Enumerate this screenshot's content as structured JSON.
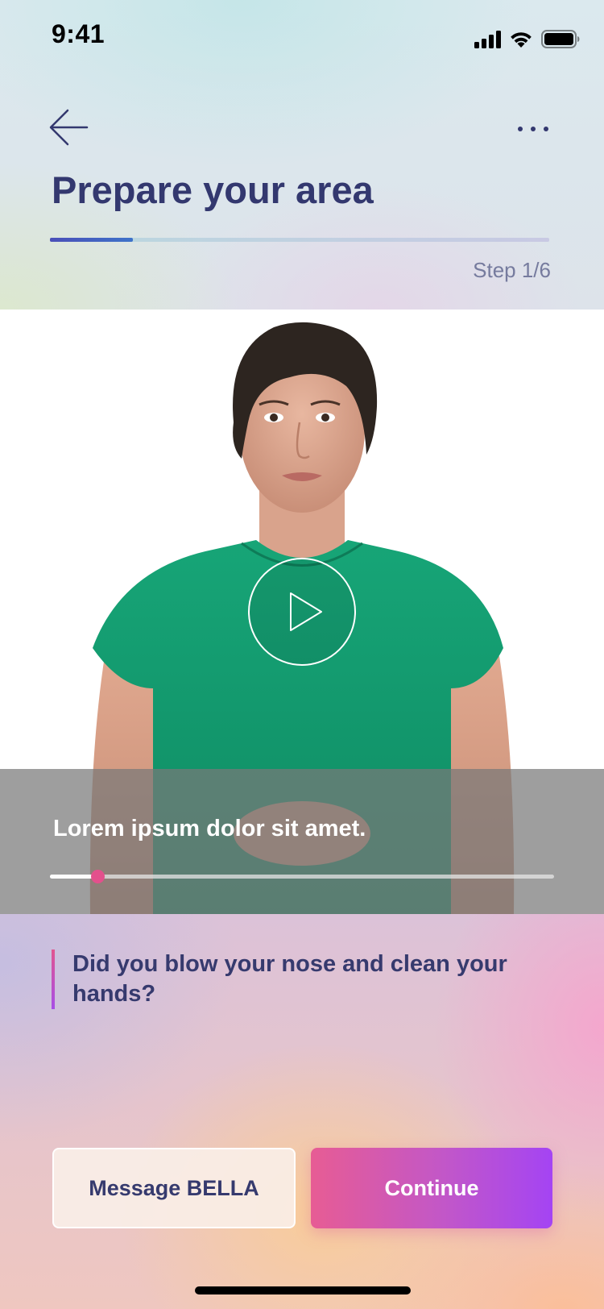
{
  "status_bar": {
    "time": "9:41",
    "signal_icon": "cellular-signal-icon",
    "wifi_icon": "wifi-icon",
    "battery_icon": "battery-full-icon"
  },
  "header": {
    "back_icon": "arrow-left-icon",
    "more_icon": "more-horizontal-icon",
    "title": "Prepare your area",
    "step_label": "Step 1/6",
    "progress_fraction": 0.1667,
    "accent_color": "#33386f"
  },
  "video": {
    "image_description_name": "presenter-video-frame",
    "play_icon": "play-icon",
    "caption": "Lorem ipsum dolor sit amet.",
    "playback_fraction": 0.095,
    "seek_handle_color": "#e3508c"
  },
  "question": {
    "text": "Did you blow your nose and clean your hands?"
  },
  "actions": {
    "message_label": "Message BELLA",
    "continue_label": "Continue",
    "continue_gradient": [
      "#e75c94",
      "#a444f3"
    ]
  }
}
